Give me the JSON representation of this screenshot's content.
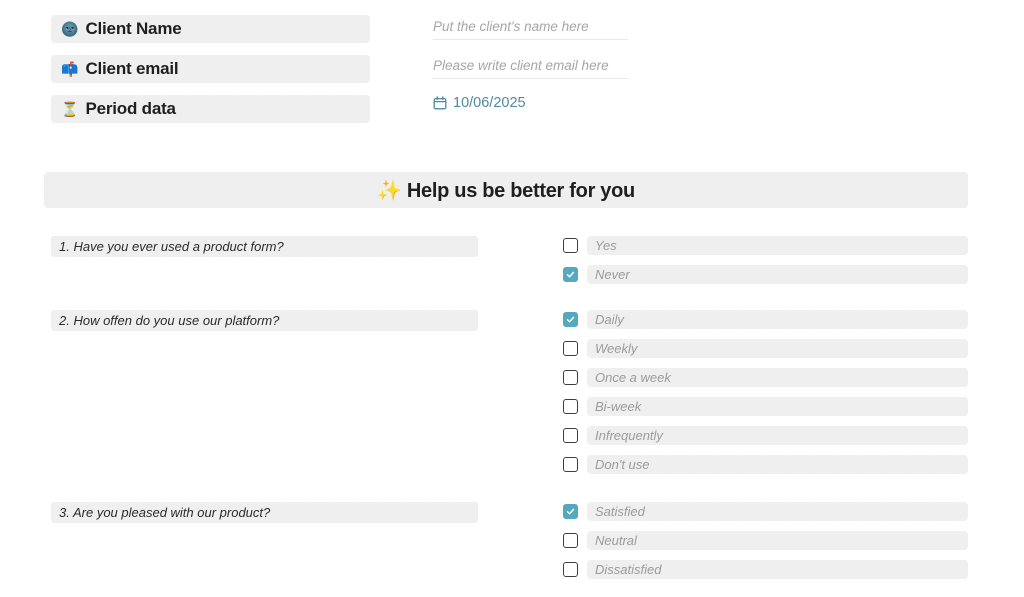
{
  "client_info": {
    "fields": [
      {
        "icon": "🌚",
        "icon_name": "moon-face-icon",
        "label": "Client Name",
        "placeholder": "Put the client's name here",
        "value": ""
      },
      {
        "icon": "📫",
        "icon_name": "mailbox-icon",
        "label": "Client email",
        "placeholder": "Please write client email here",
        "value": ""
      },
      {
        "icon": "⏳",
        "icon_name": "hourglass-icon",
        "label": "Period data",
        "value": "10/06/2025"
      }
    ],
    "date_icon_name": "calendar-icon",
    "date_color": "#4e8a9e"
  },
  "banner": {
    "title": "✨ Help us be better for you"
  },
  "survey": {
    "accent_color": "#55a8c0",
    "questions": [
      {
        "text": "1. Have you ever used a product form?",
        "options": [
          {
            "label": "Yes",
            "checked": false
          },
          {
            "label": "Never",
            "checked": true
          }
        ]
      },
      {
        "text": "2. How offen do you use our platform?",
        "options": [
          {
            "label": "Daily",
            "checked": true
          },
          {
            "label": "Weekly",
            "checked": false
          },
          {
            "label": "Once a week",
            "checked": false
          },
          {
            "label": "Bi-week",
            "checked": false
          },
          {
            "label": "Infrequently",
            "checked": false
          },
          {
            "label": "Don't use",
            "checked": false
          }
        ]
      },
      {
        "text": "3. Are you pleased with our product?",
        "options": [
          {
            "label": "Satisfied",
            "checked": true
          },
          {
            "label": "Neutral",
            "checked": false
          },
          {
            "label": "Dissatisfied",
            "checked": false
          }
        ]
      }
    ]
  }
}
